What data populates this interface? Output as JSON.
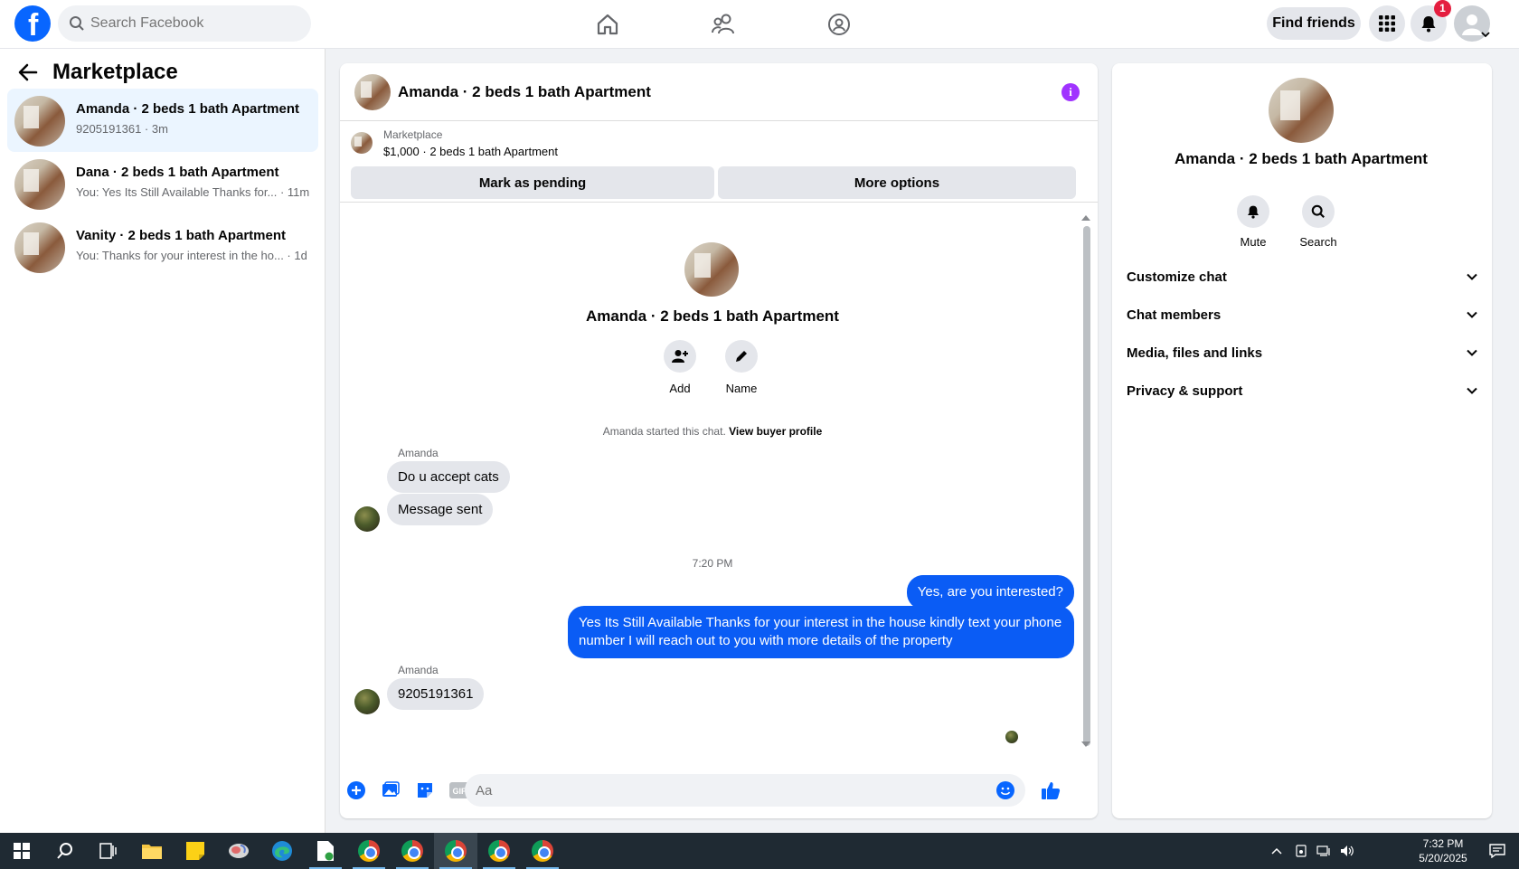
{
  "topbar": {
    "logo_letter": "f",
    "search_placeholder": "Search Facebook",
    "find_friends_label": "Find friends",
    "notification_count": "1"
  },
  "sidebar": {
    "title": "Marketplace",
    "conversations": [
      {
        "name": "Amanda · 2 beds 1 bath Apartment",
        "preview": "9205191361 · 3m",
        "active": true
      },
      {
        "name": "Dana · 2 beds 1 bath Apartment",
        "preview": "You: Yes Its Still Available Thanks for... · 11m",
        "active": false
      },
      {
        "name": "Vanity · 2 beds 1 bath Apartment",
        "preview": "You: Thanks for your interest in the ho... · 1d",
        "active": false
      }
    ]
  },
  "chat": {
    "header_title": "Amanda · 2 beds 1 bath Apartment",
    "info_icon": "i",
    "marketplace_label": "Marketplace",
    "listing_price_title": "$1,000 · 2 beds 1 bath Apartment",
    "mark_pending_label": "Mark as pending",
    "more_options_label": "More options",
    "intro_name": "Amanda · 2 beds 1 bath Apartment",
    "intro_actions": [
      {
        "label": "Add",
        "icon": "add-person-icon"
      },
      {
        "label": "Name",
        "icon": "pencil-icon"
      }
    ],
    "started_text": "Amanda started this chat.",
    "view_profile_link": "View buyer profile",
    "messages": [
      {
        "sender": "Amanda",
        "text": "Do u accept cats",
        "direction": "in"
      },
      {
        "text": "Message sent",
        "direction": "in"
      },
      {
        "timestamp": "7:20 PM"
      },
      {
        "text": "Yes, are you interested?",
        "direction": "out"
      },
      {
        "text": "Yes Its Still Available Thanks for your interest in the house kindly text your phone number I will reach out to you with more details of the property",
        "direction": "out"
      },
      {
        "sender": "Amanda",
        "text": "9205191361",
        "direction": "in"
      }
    ],
    "composer_placeholder": "Aa"
  },
  "right_panel": {
    "name": "Amanda · 2 beds 1 bath Apartment",
    "actions": [
      {
        "label": "Mute",
        "icon": "bell-icon"
      },
      {
        "label": "Search",
        "icon": "search-icon"
      }
    ],
    "sections": [
      "Customize chat",
      "Chat members",
      "Media, files and links",
      "Privacy & support"
    ]
  },
  "taskbar": {
    "time": "7:32 PM",
    "date": "5/20/2025"
  },
  "colors": {
    "brand_blue": "#0866ff",
    "outgoing_bubble": "#0a5cf5",
    "incoming_bubble": "#e4e6eb",
    "badge_red": "#e41e3f",
    "info_purple": "#a033ff"
  }
}
